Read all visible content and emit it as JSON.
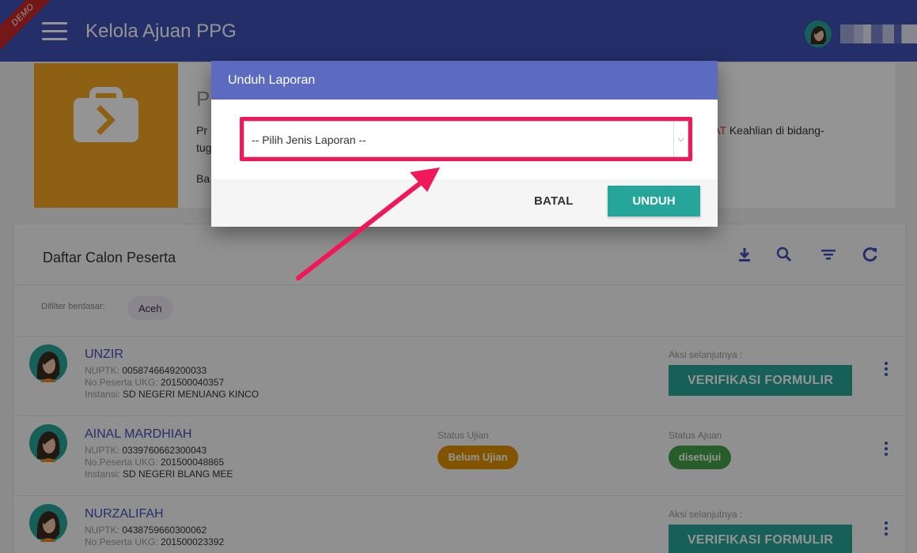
{
  "header": {
    "ribbon": "DEMO",
    "title": "Kelola Ajuan PPG"
  },
  "info_card": {
    "title": "P",
    "desc_start": "Pr",
    "desc_highlight": "KAT",
    "desc_end": " Keahlian di bidang-",
    "desc_line2": "tug",
    "desc_line3": "Ba"
  },
  "list": {
    "title": "Daftar Calon Peserta",
    "filter_label": "Difilter berdasar:",
    "filter_chip": "Aceh",
    "tools": [
      "download-icon",
      "search-icon",
      "filter-icon",
      "refresh-icon"
    ],
    "rows": [
      {
        "name": "UNZIR",
        "nuptk_label": "NUPTK: ",
        "nuptk": "0058746649200033",
        "ukg_label": "No.Peserta UKG: ",
        "ukg": "201500040357",
        "inst_label": "Instansi: ",
        "inst": "SD NEGERI MENUANG KINCO",
        "action_label": "Aksi selanjutnya :",
        "action_button": "VERIFIKASI FORMULIR"
      },
      {
        "name": "AINAL MARDHIAH",
        "nuptk_label": "NUPTK: ",
        "nuptk": "0339760662300043",
        "ukg_label": "No.Peserta UKG: ",
        "ukg": "201500048865",
        "inst_label": "Instansi: ",
        "inst": "SD NEGERI BLANG MEE",
        "exam_label": "Status Ujian",
        "exam_badge": "Belum Ujian",
        "submission_label": "Status Ajuan",
        "submission_badge": "disetujui"
      },
      {
        "name": "NURZALIFAH",
        "nuptk_label": "NUPTK: ",
        "nuptk": "0438759660300062",
        "ukg_label": "No.Peserta UKG: ",
        "ukg": "201500023392",
        "action_label": "Aksi selanjutnya :",
        "action_button": "VERIFIKASI FORMULIR"
      }
    ]
  },
  "modal": {
    "title": "Unduh Laporan",
    "select_value": "-- Pilih Jenis Laporan --",
    "cancel": "BATAL",
    "submit": "UNDUH"
  },
  "colors": {
    "header": "#3f51b5",
    "modal_header": "#5c6bc0",
    "accent": "#26a69a",
    "highlight": "#f0185b",
    "info_icon_bg": "#f5a623",
    "badge_exam": "#e09200",
    "badge_ok": "#43a047"
  }
}
